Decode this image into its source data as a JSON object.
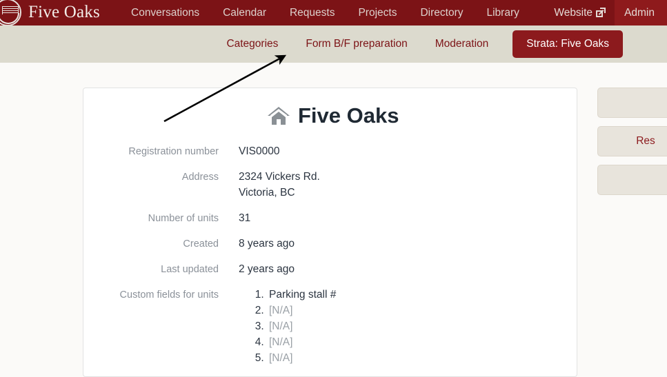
{
  "topnav": {
    "brand": "Five Oaks",
    "logo_icon": "book-circle-logo-icon",
    "links": [
      {
        "label": "Conversations"
      },
      {
        "label": "Calendar"
      },
      {
        "label": "Requests"
      },
      {
        "label": "Projects"
      },
      {
        "label": "Directory"
      },
      {
        "label": "Library"
      }
    ],
    "website_label": "Website",
    "website_icon": "external-link-icon",
    "admin_label": "Admin",
    "background_color": "#7c1316",
    "admin_background_color": "#8e1a1c"
  },
  "subnav": {
    "links": [
      {
        "label": "Categories"
      },
      {
        "label": "Form B/F preparation"
      },
      {
        "label": "Moderation"
      }
    ],
    "strata_button_label": "Strata: Five Oaks",
    "background_color": "#dcdace",
    "link_color": "#7c1316",
    "strata_button_color": "#8c1a1d"
  },
  "card": {
    "title": "Five Oaks",
    "title_icon": "house-icon",
    "rows": [
      {
        "label": "Registration number",
        "value": "VIS0000"
      },
      {
        "label": "Address",
        "line1": "2324 Vickers Rd.",
        "line2": "Victoria, BC"
      },
      {
        "label": "Number of units",
        "value": "31"
      },
      {
        "label": "Created",
        "value": "8 years ago"
      },
      {
        "label": "Last updated",
        "value": "2 years ago"
      }
    ],
    "custom_fields_label": "Custom fields for units",
    "custom_fields": [
      {
        "value": "Parking stall #",
        "empty": false
      },
      {
        "value": "[N/A]",
        "empty": true
      },
      {
        "value": "[N/A]",
        "empty": true
      },
      {
        "value": "[N/A]",
        "empty": true
      },
      {
        "value": "[N/A]",
        "empty": true
      }
    ]
  },
  "sidebar_buttons": [
    {
      "label": ""
    },
    {
      "label": "Res"
    },
    {
      "label": ""
    }
  ],
  "annotation": {
    "arrow_color": "#000000",
    "points_to": "Categories"
  }
}
